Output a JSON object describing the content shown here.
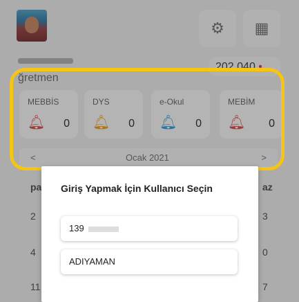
{
  "header": {
    "role": "ğretmen",
    "code_pill": "202 040",
    "gear_icon": "gear-icon",
    "qr_icon": "qr-code-icon"
  },
  "cards": [
    {
      "label": "MEBBİS",
      "count": "0",
      "bell_color": "#d9534f"
    },
    {
      "label": "DYS",
      "count": "0",
      "bell_color": "#f0a020"
    },
    {
      "label": "e-Okul",
      "count": "0",
      "bell_color": "#3aa0d8"
    },
    {
      "label": "MEBİM",
      "count": "0",
      "bell_color": "#d9534f"
    }
  ],
  "calendar": {
    "prev": "<",
    "next": ">",
    "month": "Ocak 2021",
    "visible_left": [
      "pa",
      "2",
      "4",
      "11"
    ],
    "visible_right": [
      "az",
      "3",
      "0",
      "7"
    ]
  },
  "dialog": {
    "title": "Giriş Yapmak İçin Kullanıcı Seçin",
    "options": [
      {
        "value": "139"
      },
      {
        "value": "ADIYAMAN"
      }
    ]
  },
  "colors": {
    "highlight": "#f4c416",
    "overlay": "rgba(0,0,0,0.27)"
  }
}
